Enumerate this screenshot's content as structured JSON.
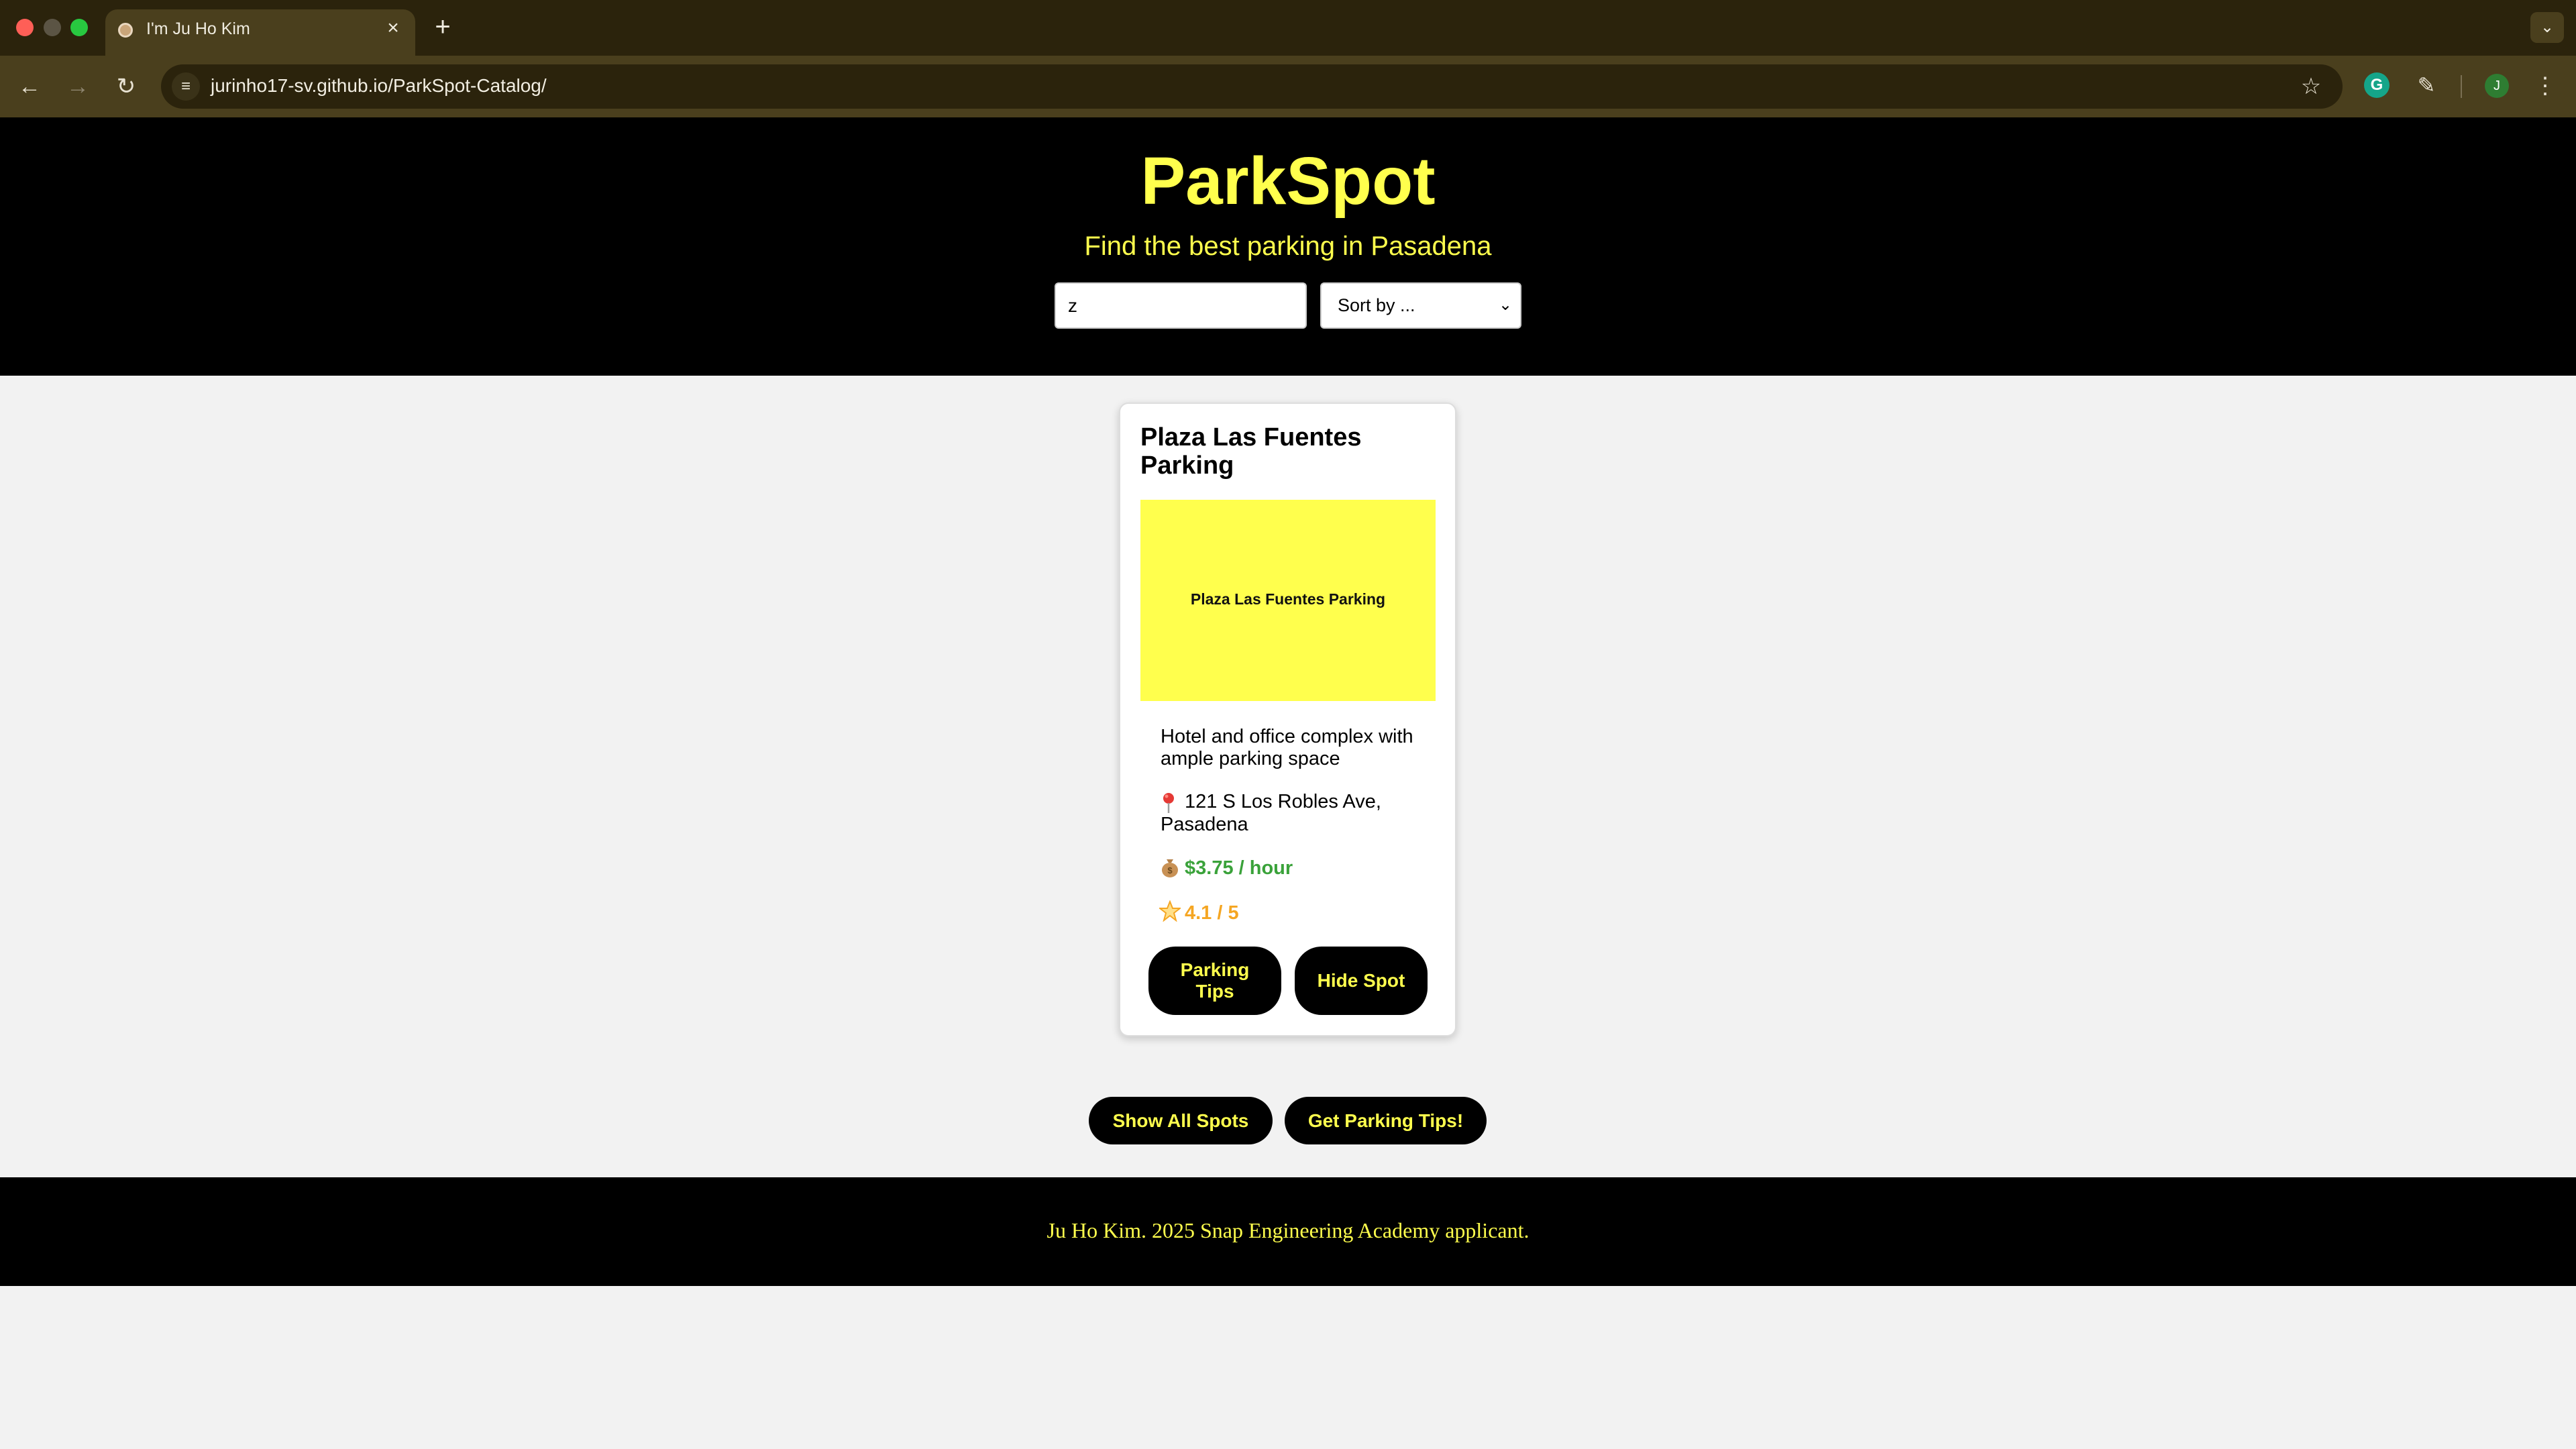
{
  "browser": {
    "tab_title": "I'm Ju Ho Kim",
    "tab_close": "×",
    "new_tab": "+",
    "url_host": "jurinho17-sv.github.io",
    "url_path": "/ParkSpot-Catalog/",
    "avatar_initial": "J",
    "icons": [
      "back-icon",
      "forward-icon",
      "reload-icon",
      "site-info-icon",
      "bookmark-star-icon",
      "grammarly-icon",
      "extensions-icon",
      "menu-icon"
    ]
  },
  "header": {
    "title": "ParkSpot",
    "subtitle": "Find the best parking in Pasadena",
    "search_value": "z",
    "sort_label": "Sort by ..."
  },
  "card": {
    "title": "Plaza Las Fuentes Parking",
    "image_label": "Plaza Las Fuentes Parking",
    "description": "Hotel and office complex with ample parking space",
    "address": "121 S Los Robles Ave, Pasadena",
    "price": "$3.75 / hour",
    "rating": "4.1 / 5",
    "tips_button": "Parking Tips",
    "hide_button": "Hide Spot"
  },
  "actions": {
    "show_all": "Show All Spots",
    "get_tips": "Get Parking Tips!"
  },
  "footer": {
    "text": "Ju Ho Kim. 2025 Snap Engineering Academy applicant."
  },
  "colors": {
    "accent_yellow": "#ffff4d",
    "header_bg": "#000000",
    "page_bg": "#f2f2f2",
    "price_green": "#3aa23a",
    "rating_orange": "#f5a623"
  }
}
